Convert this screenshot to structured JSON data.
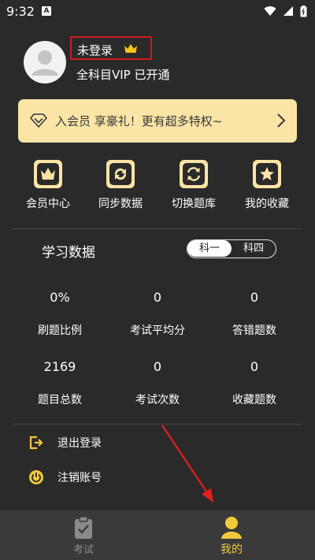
{
  "status_bar": {
    "time": "9:32",
    "app_badge": "A"
  },
  "profile": {
    "name": "未登录",
    "vip_status": "全科目VIP 已开通"
  },
  "banner": {
    "text": "入会员 享豪礼！更有超多特权~"
  },
  "quick_actions": [
    {
      "label": "会员中心",
      "icon": "crown-icon"
    },
    {
      "label": "同步数据",
      "icon": "sync-icon"
    },
    {
      "label": "切换题库",
      "icon": "switch-icon"
    },
    {
      "label": "我的收藏",
      "icon": "star-icon"
    }
  ],
  "study": {
    "title": "学习数据",
    "segments": [
      "科一",
      "科四"
    ],
    "active_segment": "科一",
    "stats": [
      {
        "value": "0%",
        "label": "刷题比例"
      },
      {
        "value": "0",
        "label": "考试平均分"
      },
      {
        "value": "0",
        "label": "答错题数"
      },
      {
        "value": "2169",
        "label": "题目总数"
      },
      {
        "value": "0",
        "label": "考试次数"
      },
      {
        "value": "0",
        "label": "收藏题数"
      }
    ]
  },
  "actions": [
    {
      "label": "退出登录",
      "icon": "logout-icon"
    },
    {
      "label": "注销账号",
      "icon": "power-icon"
    }
  ],
  "tabs": [
    {
      "label": "考试",
      "icon": "clipboard-icon",
      "active": false
    },
    {
      "label": "我的",
      "icon": "user-icon",
      "active": true
    }
  ],
  "colors": {
    "background": "#2a2a2a",
    "accent": "#fae4a6",
    "gold": "#f0c93c",
    "highlight_box": "#d2181e",
    "annotation_arrow": "#e0201e"
  }
}
